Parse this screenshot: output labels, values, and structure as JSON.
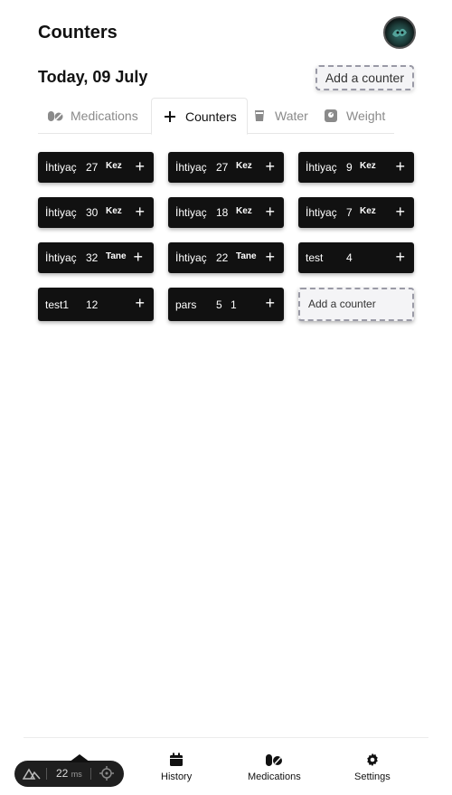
{
  "header": {
    "title": "Counters"
  },
  "date_row": {
    "date": "Today, 09 July",
    "add_label": "Add a counter"
  },
  "tabs": [
    {
      "label": "Medications",
      "icon": "pill-icon",
      "active": false
    },
    {
      "label": "Counters",
      "icon": "plus-icon",
      "active": true
    },
    {
      "label": "Water",
      "icon": "glass-icon",
      "active": false
    },
    {
      "label": "Weight",
      "icon": "scale-icon",
      "active": false
    }
  ],
  "counters": [
    {
      "name": "İhtiyaç",
      "count": "27",
      "unit": "Kez"
    },
    {
      "name": "İhtiyaç",
      "count": "27",
      "unit": "Kez"
    },
    {
      "name": "İhtiyaç",
      "count": "9",
      "unit": "Kez"
    },
    {
      "name": "İhtiyaç",
      "count": "30",
      "unit": "Kez"
    },
    {
      "name": "İhtiyaç",
      "count": "18",
      "unit": "Kez"
    },
    {
      "name": "İhtiyaç",
      "count": "7",
      "unit": "Kez"
    },
    {
      "name": "İhtiyaç",
      "count": "32",
      "unit": "Tane"
    },
    {
      "name": "İhtiyaç",
      "count": "22",
      "unit": "Tane"
    },
    {
      "name": "test",
      "count": "4",
      "unit": ""
    },
    {
      "name": "test1",
      "count": "12",
      "unit": ""
    },
    {
      "name": "pars",
      "count": "5",
      "unit": "1"
    }
  ],
  "plus_symbol": "+",
  "grid_add_label": "Add a counter",
  "bottom_nav": [
    {
      "label": "History",
      "icon": "calendar-icon"
    },
    {
      "label": "Medications",
      "icon": "pill-icon"
    },
    {
      "label": "Settings",
      "icon": "gear-icon"
    }
  ],
  "dev_bar": {
    "time": "22",
    "unit": "ms"
  }
}
